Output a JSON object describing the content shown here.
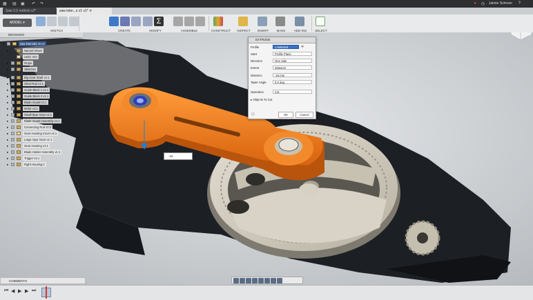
{
  "titlebar": {
    "doc_tabs": [
      "Saw 2.0 redlock v2*",
      "saw inter...x v1 v1*"
    ],
    "user": "Jaimie Schever"
  },
  "toolbar": {
    "workspace": "MODEL",
    "groups": [
      "SKETCH",
      "CREATE",
      "MODIFY",
      "ASSEMBLE",
      "CONSTRUCT",
      "INSPECT",
      "INSERT",
      "MAKE",
      "ADD-INS",
      "SELECT"
    ]
  },
  "browser": {
    "title": "BROWSER",
    "root": "saw internals v1 v1",
    "items": [
      {
        "label": "Named Views"
      },
      {
        "label": "Units: mm"
      },
      {
        "label": "Origin"
      },
      {
        "label": "Sketches"
      },
      {
        "label": "Big Gear Shaft v1:1"
      },
      {
        "label": "Short Rod v1:1"
      },
      {
        "label": "Guide Block 1 v1:1"
      },
      {
        "label": "Guide Block 2 v1:1"
      },
      {
        "label": "Blade Guard v1:1"
      },
      {
        "label": "Motor v1:1"
      },
      {
        "label": "Small Spur Gear v1:1"
      },
      {
        "label": "Blade Guard Assembly v1:1"
      },
      {
        "label": "Connecting Rod v1:1"
      },
      {
        "label": "Gear Housing Cover v1:1"
      },
      {
        "label": "Large Spur Gear v1:1"
      },
      {
        "label": "Gear Housing v1:1"
      },
      {
        "label": "Blade Holder Assembly v1:1"
      },
      {
        "label": "Trigger v1:1"
      },
      {
        "label": "Right Housing:1"
      }
    ]
  },
  "extrude": {
    "title": "EXTRUDE",
    "rows": [
      {
        "label": "Profile",
        "value": "1 selected"
      },
      {
        "label": "Start",
        "value": "Profile Plane"
      },
      {
        "label": "Direction",
        "value": "One Side"
      },
      {
        "label": "Extent",
        "value": "Distance"
      },
      {
        "label": "Distance",
        "value": "-15 mm"
      },
      {
        "label": "Taper Angle",
        "value": "0.0 deg"
      },
      {
        "label": "Operation",
        "value": "Cut"
      }
    ],
    "objects_to_cut": "Objects To Cut",
    "ok": "OK",
    "cancel": "Cancel"
  },
  "dimension_input": {
    "value": "-15"
  },
  "comments": {
    "label": "COMMENTS"
  },
  "colors": {
    "toolbar_bg": "#e9eaeb",
    "rod": "#ee7a1c",
    "housing": "#1e2126",
    "gear": "#cfc9b9",
    "accent": "#3c5b8f"
  }
}
